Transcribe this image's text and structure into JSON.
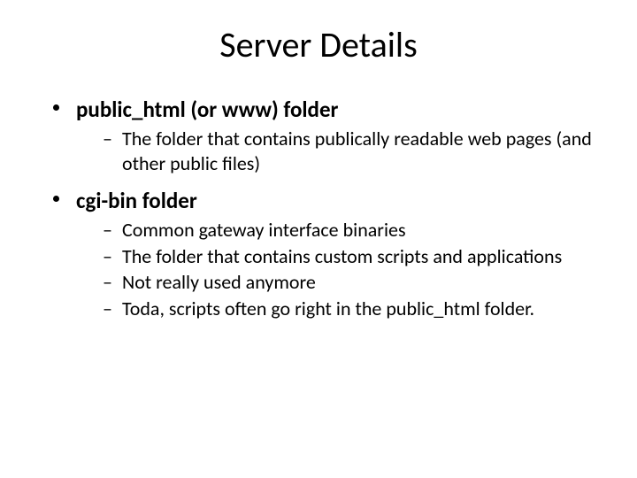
{
  "title": "Server Details",
  "bullets": [
    {
      "heading": "public_html  (or www) folder",
      "subs": [
        "The folder that contains publically readable web pages (and other public files)"
      ]
    },
    {
      "heading": "cgi-bin folder",
      "subs": [
        "Common gateway interface binaries",
        "The folder that contains custom scripts and applications",
        "Not really used anymore",
        "Toda, scripts often go right in the public_html folder."
      ]
    }
  ],
  "dash": "–"
}
